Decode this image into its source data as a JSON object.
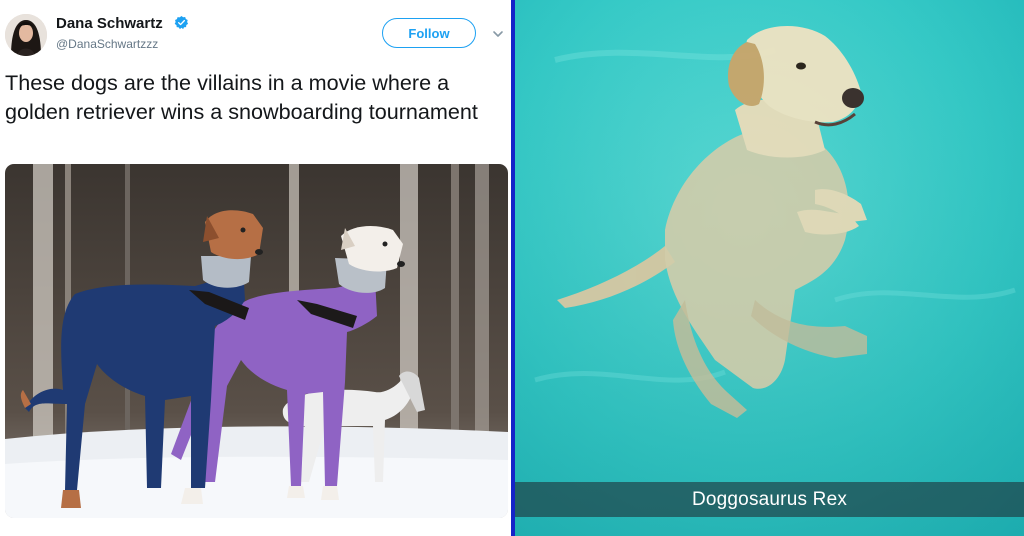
{
  "tweet": {
    "user_name": "Dana Schwartz",
    "user_handle": "@DanaSchwartzzz",
    "follow_label": "Follow",
    "text": "These dogs are the villains in a movie where a golden retriever wins a snowboarding tournament",
    "verified_icon": "verified-badge-icon",
    "menu_icon": "chevron-down-icon",
    "colors": {
      "accent": "#1da1f2",
      "text": "#14171a",
      "secondary": "#657786"
    }
  },
  "snap": {
    "caption": "Doggosaurus Rex"
  }
}
